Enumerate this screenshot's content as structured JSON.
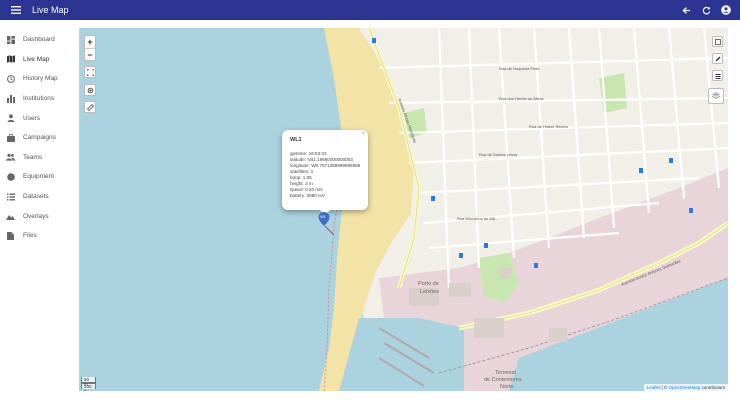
{
  "header": {
    "title": "Live Map",
    "icons": [
      "menu-icon",
      "back-arrow-icon",
      "refresh-icon",
      "account-icon"
    ]
  },
  "sidebar": {
    "items": [
      {
        "label": "Dashboard",
        "icon": "dashboard-icon"
      },
      {
        "label": "Live Map",
        "icon": "map-icon",
        "active": true
      },
      {
        "label": "History Map",
        "icon": "history-icon"
      },
      {
        "label": "Institutions",
        "icon": "institution-icon"
      },
      {
        "label": "Users",
        "icon": "user-icon"
      },
      {
        "label": "Campaigns",
        "icon": "campaign-icon"
      },
      {
        "label": "Teams",
        "icon": "team-icon"
      },
      {
        "label": "Equipment",
        "icon": "equipment-icon"
      },
      {
        "label": "Datasets",
        "icon": "dataset-icon"
      },
      {
        "label": "Overlays",
        "icon": "overlay-icon"
      },
      {
        "label": "Files",
        "icon": "file-icon"
      }
    ]
  },
  "map": {
    "zoom_in": "+",
    "zoom_out": "−",
    "popup": {
      "title": "WL1",
      "close": "×",
      "lines": [
        "gpstime: 16:53:23",
        "latitude: N41.19860000000003",
        "longitude: W8.7071399999999995",
        "satellites: 3",
        "hdop: 1.05",
        "height: 3 m",
        "speed: 0.20 m/s",
        "battery: 3980 mV"
      ]
    },
    "marker_label": "WL",
    "scale": {
      "metric": "50 m",
      "imperial": "200 ft"
    },
    "attribution": {
      "leaflet": "Leaflet",
      "sep": " | © ",
      "osm": "OpenStreetMap",
      "suffix": " contributors"
    },
    "labels": {
      "porto": "Porto de",
      "leixoes": "Leixões",
      "terminal": "Terminal",
      "contentores": "de Contentores",
      "norte": "Norte",
      "rua_noqueira": "Rua de Noqueira Pinto",
      "rua_heroi": "Rua dos Heróis de África",
      "rua_santos": "Rua de Santos Lessa",
      "rua_horizonte": "Rua de Hintze Ribeiro",
      "av_afonso": "Avenida Afonso Henriques",
      "av_guimaraes": "Avenida Doutor Antunes Guimarães",
      "rua_brito": "Rua Mouzinho de Alb..."
    },
    "colors": {
      "sea": "#aad3df",
      "beach": "#f3e3a7",
      "land": "#f2efe9",
      "port": "#e9d5d9",
      "park": "#c8e6b0",
      "road_major": "#f6fabe",
      "marker": "#3d6fc6"
    }
  }
}
